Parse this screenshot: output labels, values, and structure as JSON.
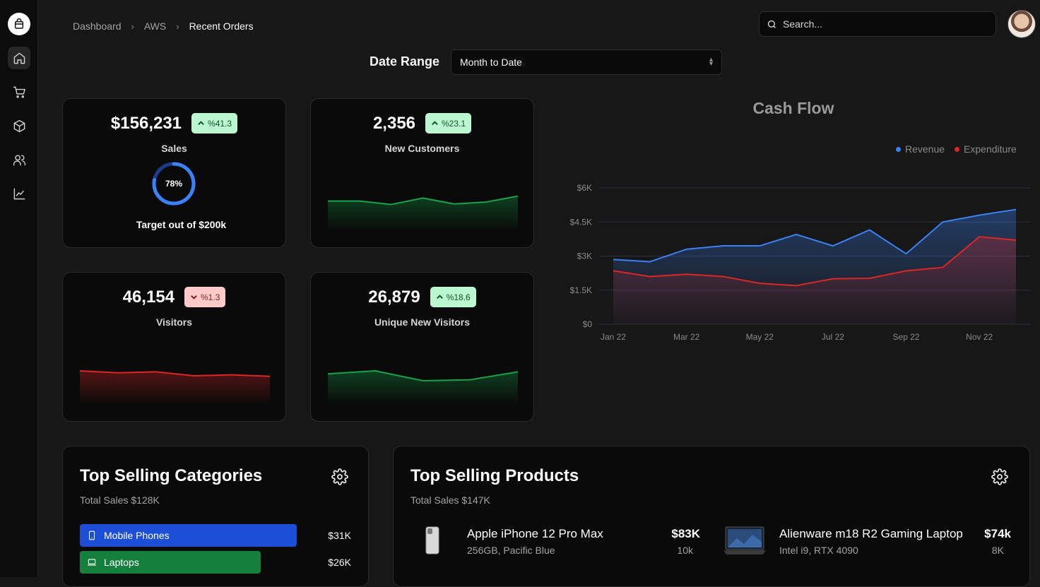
{
  "breadcrumb": {
    "items": [
      "Dashboard",
      "AWS"
    ],
    "current": "Recent Orders"
  },
  "search": {
    "placeholder": "Search..."
  },
  "date_range": {
    "label": "Date Range",
    "selected": "Month to Date"
  },
  "stats": {
    "sales": {
      "value": "$156,231",
      "change": "%41.3",
      "trend": "up",
      "label": "Sales",
      "progress_percent": 78,
      "progress_text": "78%",
      "target": "Target out of $200k"
    },
    "customers": {
      "value": "2,356",
      "change": "%23.1",
      "trend": "up",
      "label": "New Customers",
      "spark": [
        62,
        62,
        55,
        68,
        56,
        60,
        72
      ]
    },
    "visitors": {
      "value": "46,154",
      "change": "%1.3",
      "trend": "down",
      "label": "Visitors",
      "spark": [
        70,
        66,
        68,
        60,
        62,
        59
      ]
    },
    "unique": {
      "value": "26,879",
      "change": "%18.6",
      "trend": "up",
      "label": "Unique New Visitors",
      "spark": [
        64,
        70,
        50,
        52,
        68
      ]
    }
  },
  "colors": {
    "revenue": "#3b82f6",
    "expenditure": "#dc2626",
    "green": "#16a34a",
    "mobile": "#1d4ed8",
    "laptops": "#15803d"
  },
  "chart_data": {
    "type": "area",
    "title": "Cash Flow",
    "x": [
      "Jan 22",
      "Feb 22",
      "Mar 22",
      "Apr 22",
      "May 22",
      "Jun 22",
      "Jul 22",
      "Aug 22",
      "Sep 22",
      "Oct 22",
      "Nov 22",
      "Dec 22"
    ],
    "x_tick_labels": [
      "Jan 22",
      "Mar 22",
      "May 22",
      "Jul 22",
      "Sep 22",
      "Nov 22"
    ],
    "y_tick_labels": [
      "$0",
      "$1.5K",
      "$3K",
      "$4.5K",
      "$6K"
    ],
    "ylim": [
      0,
      6000
    ],
    "legend": "top-right",
    "grid": true,
    "series": [
      {
        "name": "Revenue",
        "values": [
          2850,
          2750,
          3300,
          3450,
          3450,
          3950,
          3450,
          4150,
          3100,
          4500,
          4800,
          5050
        ]
      },
      {
        "name": "Expenditure",
        "values": [
          2350,
          2100,
          2200,
          2100,
          1800,
          1700,
          2000,
          2020,
          2350,
          2500,
          3850,
          3700
        ]
      }
    ]
  },
  "categories": {
    "title": "Top Selling Categories",
    "subtitle": "Total Sales $128K",
    "items": [
      {
        "name": "Mobile Phones",
        "value": "$31K",
        "share": 0.97
      },
      {
        "name": "Laptops",
        "value": "$26K",
        "share": 0.81
      }
    ]
  },
  "products": {
    "title": "Top Selling Products",
    "subtitle": "Total Sales $147K",
    "items": [
      {
        "name": "Apple iPhone 12 Pro Max",
        "desc": "256GB, Pacific Blue",
        "price": "$83K",
        "count": "10k"
      },
      {
        "name": "Alienware m18 R2 Gaming Laptop",
        "desc": "Intel i9, RTX 4090",
        "price": "$74k",
        "count": "8K"
      }
    ]
  }
}
